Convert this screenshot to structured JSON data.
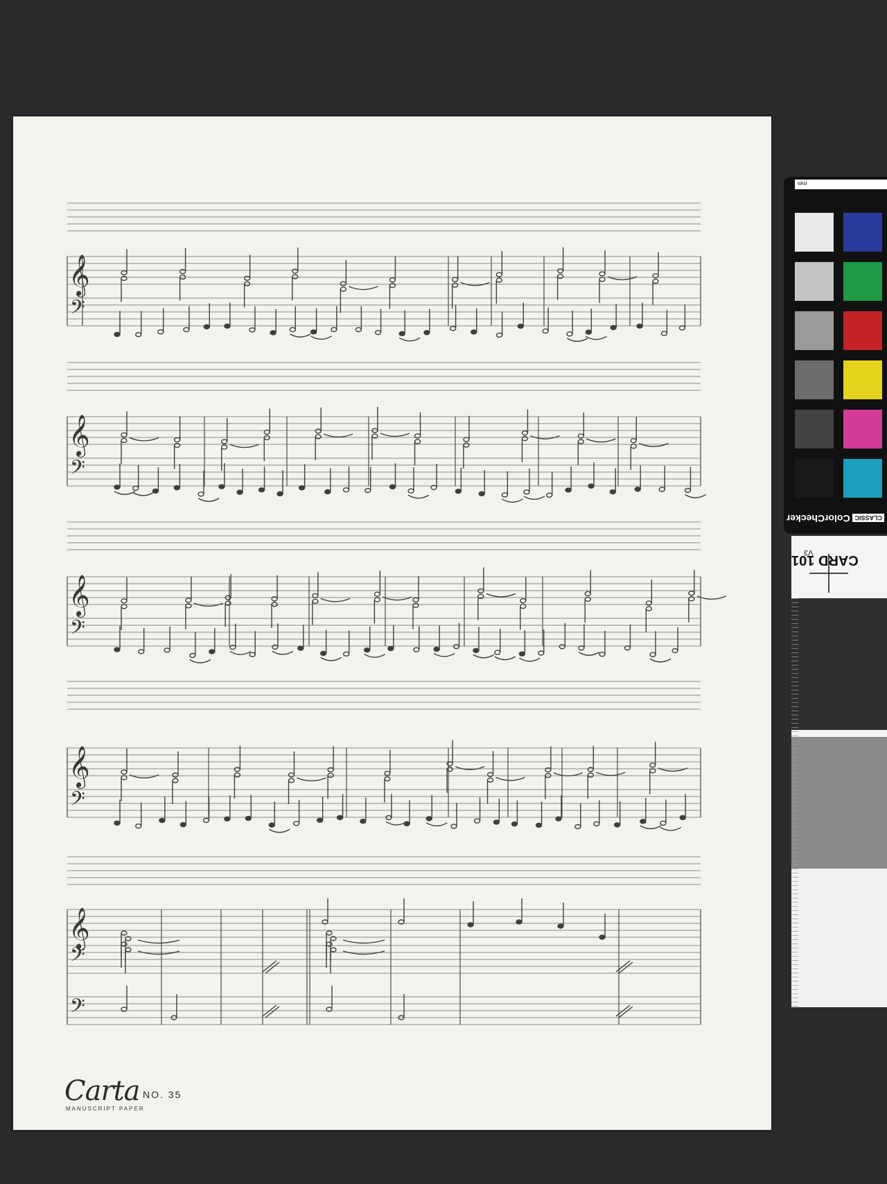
{
  "paper": {
    "brand_script": "Carta",
    "brand_subtitle": "MANUSCRIPT PAPER",
    "number_label": "NO. 35"
  },
  "color_checker": {
    "unit_label": "mm",
    "brand": "ColorChecker",
    "tag": "CLASSIC",
    "swatches_left": [
      "#e9e9e7",
      "#c4c4c2",
      "#9a9a98",
      "#6c6c6a",
      "#444443",
      "#1a1a1a"
    ],
    "swatches_right": [
      "#2a3a9e",
      "#1f9a45",
      "#c42226",
      "#e5d21c",
      "#d43a9a",
      "#1b9ec0"
    ]
  },
  "gray_card": {
    "title": "CARD 101",
    "version": "V3"
  },
  "score": {
    "clef_treble": "𝄞",
    "clef_bass": "𝄢"
  }
}
